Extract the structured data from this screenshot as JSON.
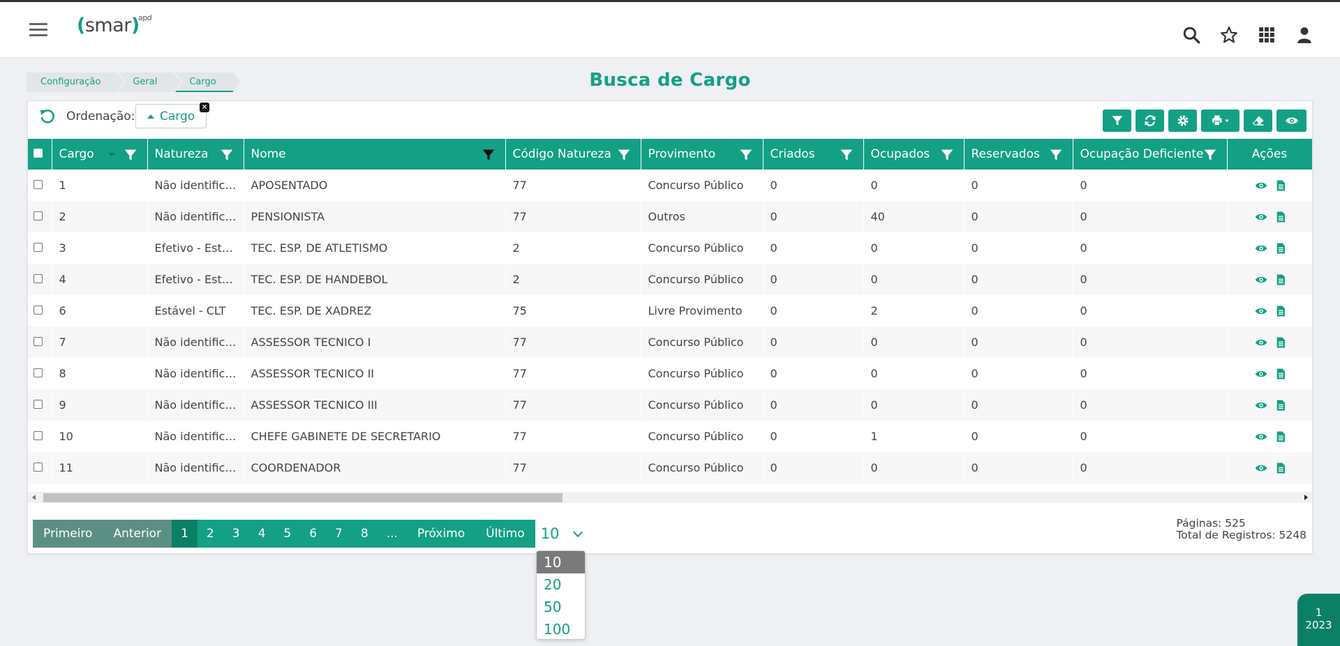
{
  "app": {
    "logo_text": "smar",
    "logo_sup": "apd"
  },
  "breadcrumb": [
    "Configuração",
    "Geral",
    "Cargo"
  ],
  "page": {
    "title": "Busca de Cargo"
  },
  "ordering": {
    "label": "Ordenação:",
    "chip": "Cargo",
    "close": "×"
  },
  "table": {
    "columns": [
      "Cargo",
      "Natureza",
      "Nome",
      "Código Natureza",
      "Provimento",
      "Criados",
      "Ocupados",
      "Reservados",
      "Ocupação Deficiente",
      "Ações"
    ],
    "rows": [
      [
        "1",
        "Não identificado",
        "APOSENTADO",
        "77",
        "Concurso Público",
        "0",
        "0",
        "0",
        "0"
      ],
      [
        "2",
        "Não identificado",
        "PENSIONISTA",
        "77",
        "Outros",
        "0",
        "40",
        "0",
        "0"
      ],
      [
        "3",
        "Efetivo - Estatutário",
        "TEC. ESP. DE ATLETISMO",
        "2",
        "Concurso Público",
        "0",
        "0",
        "0",
        "0"
      ],
      [
        "4",
        "Efetivo - Estatutário",
        "TEC. ESP. DE HANDEBOL",
        "2",
        "Concurso Público",
        "0",
        "0",
        "0",
        "0"
      ],
      [
        "6",
        "Estável - CLT",
        "TEC. ESP. DE XADREZ",
        "75",
        "Livre Provimento",
        "0",
        "2",
        "0",
        "0"
      ],
      [
        "7",
        "Não identificado",
        "ASSESSOR TECNICO I",
        "77",
        "Concurso Público",
        "0",
        "0",
        "0",
        "0"
      ],
      [
        "8",
        "Não identificado",
        "ASSESSOR TECNICO II",
        "77",
        "Concurso Público",
        "0",
        "0",
        "0",
        "0"
      ],
      [
        "9",
        "Não identificado",
        "ASSESSOR TECNICO III",
        "77",
        "Concurso Público",
        "0",
        "0",
        "0",
        "0"
      ],
      [
        "10",
        "Não identificado",
        "CHEFE GABINETE DE SECRETARIO",
        "77",
        "Concurso Público",
        "0",
        "1",
        "0",
        "0"
      ],
      [
        "11",
        "Não identificado",
        "COORDENADOR",
        "77",
        "Concurso Público",
        "0",
        "0",
        "0",
        "0"
      ]
    ]
  },
  "pagination": {
    "first": "Primeiro",
    "prev": "Anterior",
    "pages": [
      "1",
      "2",
      "3",
      "4",
      "5",
      "6",
      "7",
      "8",
      "..."
    ],
    "next": "Próximo",
    "last": "Último",
    "page_size": "10",
    "page_size_options": [
      "10",
      "20",
      "50",
      "100"
    ],
    "pages_total": "Páginas: 525",
    "records_total": "Total de Registros: 5248"
  },
  "badge": {
    "line1": "1",
    "line2": "2023"
  },
  "colors": {
    "accent": "#13a085",
    "accent_dark": "#0b8066",
    "nav": "#5c8f84"
  }
}
